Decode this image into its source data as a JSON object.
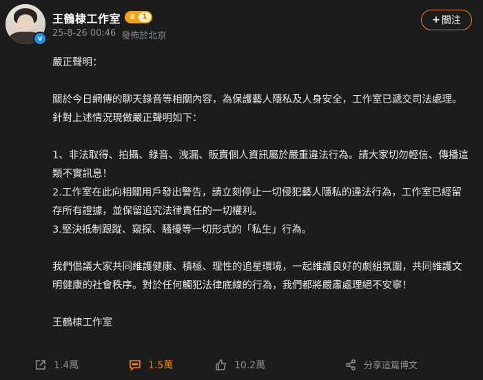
{
  "header": {
    "name": "王鶴棣工作室",
    "level": "1",
    "timestamp": "25-8-26 00:46",
    "location": "發佈於北京",
    "follow_label": "關注"
  },
  "post": {
    "title": "嚴正聲明：",
    "intro": "關於今日網傳的聊天錄音等相關內容，為保護藝人隱私及人身安全，工作室已遞交司法處理。針對上述情況現做嚴正聲明如下：",
    "items": [
      "1、非法取得、拍攝、錄音、洩漏、販賣個人資訊屬於嚴重違法行為。請大家切勿輕信、傳播這類不實訊息！",
      "2.工作室在此向相關用戶發出警告，請立刻停止一切侵犯藝人隱私的違法行為，工作室已經留存所有證據，並保留追究法律責任的一切權利。",
      "3.堅決抵制跟蹤、窺探、騷擾等一切形式的「私生」行為。"
    ],
    "closing": "我們倡議大家共同維護健康、積極、理性的追星環境，一起維護良好的劇組氛圍，共同維護文明健康的社會秩序。對於任何觸犯法律底線的行為，我們都將嚴肅處理絕不安寧！",
    "signature": "王鶴棣工作室"
  },
  "actions": {
    "repost_count": "1.4萬",
    "comment_count": "1.5萬",
    "like_count": "10.2萬",
    "share_label": "分享這篇博文"
  },
  "colors": {
    "background": "#1c1c1c",
    "accent": "#ff8200",
    "verified": "#1d8ef7",
    "badge": "#f2a31c"
  }
}
